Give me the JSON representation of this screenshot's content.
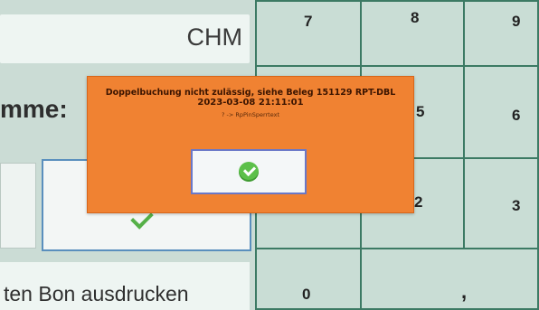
{
  "left_panel": {
    "currency": "CHM",
    "sum_label": "mme:",
    "print_receipt_label": "ten Bon ausdrucken"
  },
  "keypad": {
    "keys": [
      "7",
      "8",
      "9",
      "5",
      "6",
      "2",
      "3",
      "0",
      ","
    ]
  },
  "dialog": {
    "message": "Doppelbuchung nicht zulässig, siehe Beleg 151129 RPT-DBL",
    "timestamp": "2023-03-08 21:11:01",
    "subtext": "? -> RpPinSperrtext",
    "ok_icon": "check-circle-icon"
  },
  "colors": {
    "dialog_bg": "#f08232",
    "keypad_border": "#3c7a64",
    "ok_check": "#5cc04a"
  }
}
